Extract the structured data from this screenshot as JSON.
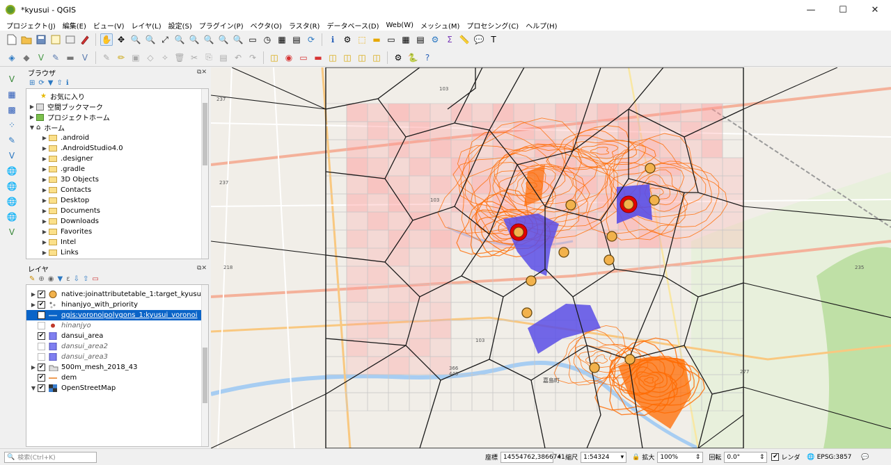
{
  "window": {
    "title": "*kyusui - QGIS",
    "minimize": "—",
    "maximize": "☐",
    "close": "✕"
  },
  "menu": [
    "プロジェクト(J)",
    "編集(E)",
    "ビュー(V)",
    "レイヤ(L)",
    "設定(S)",
    "プラグイン(P)",
    "ベクタ(O)",
    "ラスタ(R)",
    "データベース(D)",
    "Web(W)",
    "メッシュ(M)",
    "プロセシング(C)",
    "ヘルプ(H)"
  ],
  "browser": {
    "title": "ブラウザ",
    "items": [
      {
        "label": "お気に入り",
        "icon": "star-icon"
      },
      {
        "label": "空間ブックマーク",
        "icon": "bookmark-icon"
      },
      {
        "label": "プロジェクトホーム",
        "icon": "project-home-icon"
      },
      {
        "label": "ホーム",
        "icon": "home-icon"
      },
      {
        "label": ".android"
      },
      {
        "label": ".AndroidStudio4.0"
      },
      {
        "label": ".designer"
      },
      {
        "label": ".gradle"
      },
      {
        "label": "3D Objects"
      },
      {
        "label": "Contacts"
      },
      {
        "label": "Desktop"
      },
      {
        "label": "Documents"
      },
      {
        "label": "Downloads"
      },
      {
        "label": "Favorites"
      },
      {
        "label": "Intel"
      },
      {
        "label": "Links"
      }
    ]
  },
  "layers": {
    "title": "レイヤ",
    "items": [
      {
        "label": "native:joinattributetable_1:target_kyusui",
        "checked": true,
        "symbol": "orange-circle"
      },
      {
        "label": "hinanjyo_with_priority",
        "checked": true,
        "symbol": "dots"
      },
      {
        "label": "qgis:voronoipolygons_1:kyusui_voronoi",
        "checked": true,
        "symbol": "line-black",
        "selected": true
      },
      {
        "label": "hinanjyo",
        "checked": false,
        "symbol": "red-dot",
        "italic": true
      },
      {
        "label": "dansui_area",
        "checked": true,
        "symbol": "blue-square"
      },
      {
        "label": "dansui_area2",
        "checked": false,
        "symbol": "blue-square",
        "italic": true
      },
      {
        "label": "dansui_area3",
        "checked": false,
        "symbol": "blue-square",
        "italic": true
      },
      {
        "label": "500m_mesh_2018_43",
        "checked": true,
        "symbol": "group"
      },
      {
        "label": "dem",
        "checked": true,
        "symbol": "orange-line"
      },
      {
        "label": "OpenStreetMap",
        "checked": true,
        "symbol": "grid"
      }
    ]
  },
  "status": {
    "search_placeholder": "検索(Ctrl+K)",
    "coord_label": "座標",
    "coord_value": "14554762,3866741",
    "scale_label": "縮尺",
    "scale_value": "1:54324",
    "magnify_label": "拡大",
    "magnify_value": "100%",
    "rotation_label": "回転",
    "rotation_value": "0.0°",
    "render_label": "レンダ",
    "crs": "EPSG:3857"
  },
  "map_labels": [
    "237",
    "237",
    "235",
    "103",
    "103",
    "103",
    "218",
    "366",
    "445",
    "277",
    "嘉島町"
  ],
  "colors": {
    "voronoi": "#1a1a1a",
    "mesh": "#ff9a9a",
    "dansui": "#5a4ee6",
    "contour": "#ff6a00",
    "point": "#f2b24c",
    "priority": "#e10000"
  }
}
